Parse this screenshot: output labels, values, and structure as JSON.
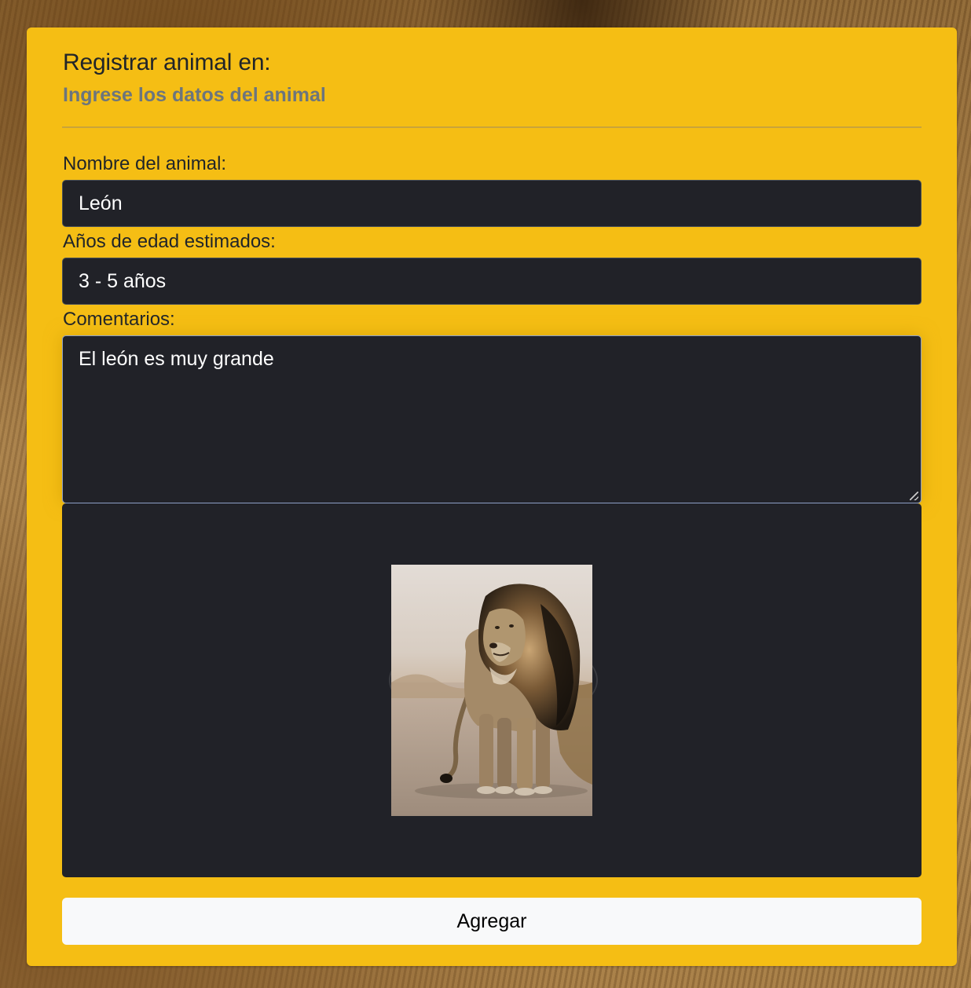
{
  "card": {
    "title": "Registrar animal en:",
    "subtitle": "Ingrese los datos del animal"
  },
  "form": {
    "name_label": "Nombre del animal:",
    "name_value": "León",
    "age_label": "Años de edad estimados:",
    "age_value": "3 - 5 años",
    "comments_label": "Comentarios:",
    "comments_value": "El león es muy grande",
    "submit_label": "Agregar"
  },
  "preview": {
    "image_subject": "lion-photo"
  },
  "colors": {
    "card_background": "#f5be14",
    "input_background": "#212228",
    "subtitle": "#6c757d",
    "button_background": "#f8f9fa"
  }
}
